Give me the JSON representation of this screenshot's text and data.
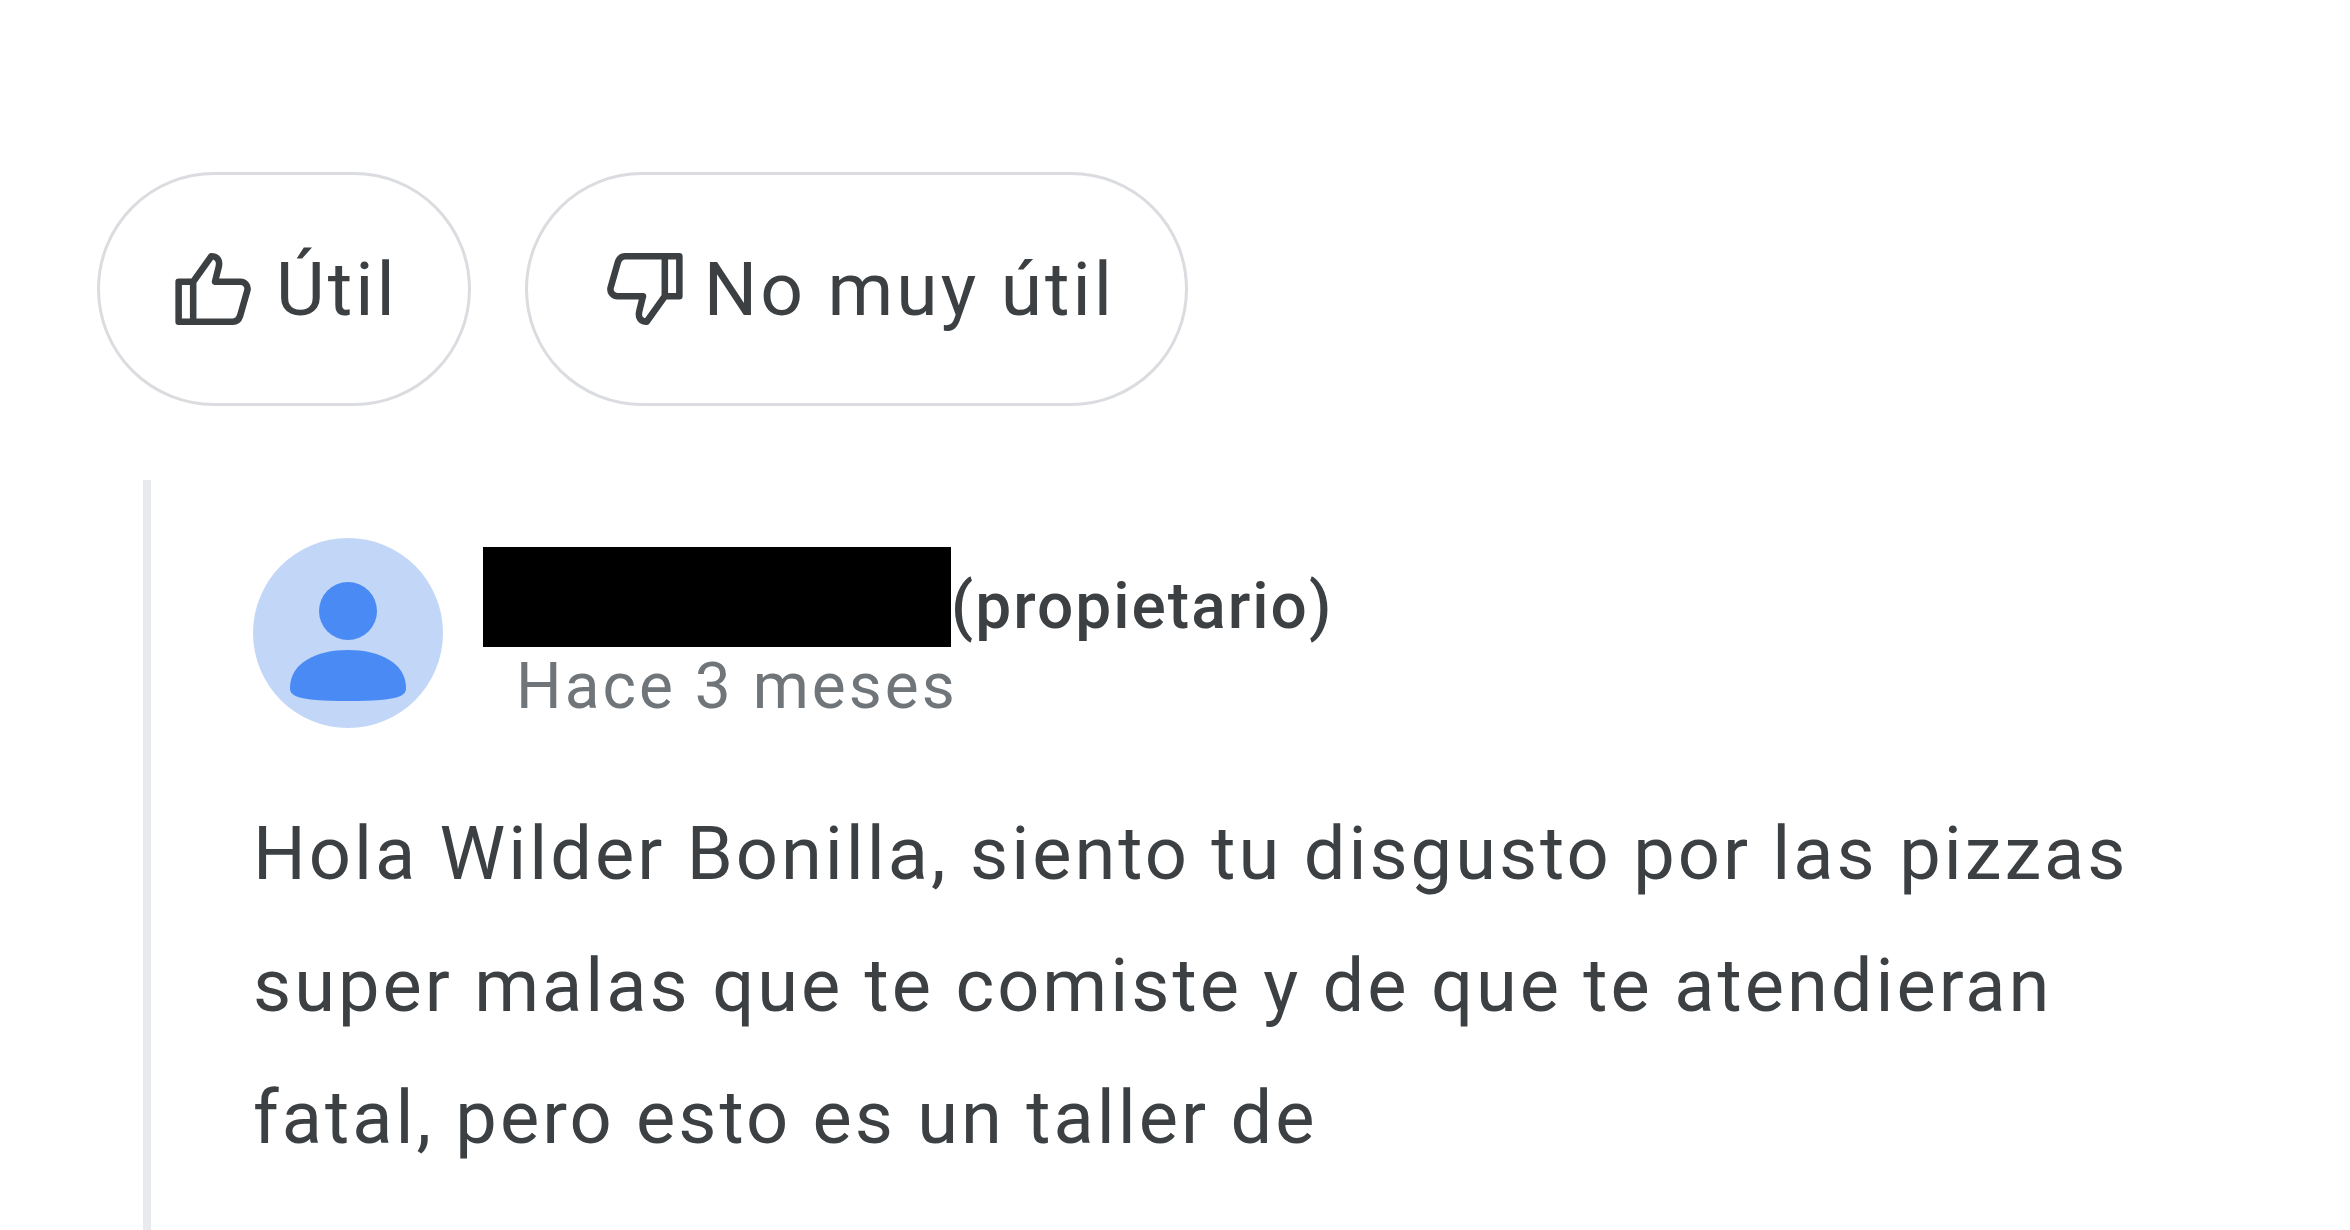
{
  "review_actions": [
    {
      "kind": "helpful",
      "label": "Útil"
    },
    {
      "kind": "not_helpful",
      "label": "No muy útil"
    }
  ],
  "owner_reply": {
    "author_redacted": true,
    "role": "(propietario)",
    "time": "Hace 3 meses",
    "text": "Hola Wilder Bonilla, siento tu disgusto por las pizzas super malas que te comiste y de que te atendieran fatal, pero esto es un taller de"
  }
}
